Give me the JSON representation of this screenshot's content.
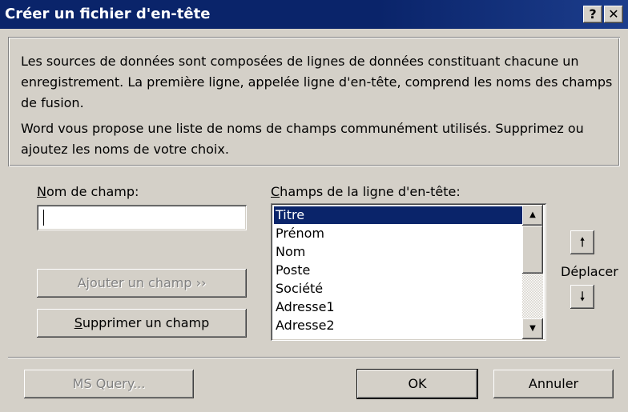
{
  "window": {
    "title": "Créer un fichier d'en-tête",
    "help_label": "?",
    "close_label": "✕"
  },
  "info": {
    "paragraph1": "Les sources de données sont composées de lignes de données constituant chacune un enregistrement. La première ligne, appelée ligne d'en-tête, comprend les noms des champs de fusion.",
    "paragraph2": "Word vous propose une liste de noms de champs communément utilisés. Supprimez ou ajoutez les noms de votre choix."
  },
  "field_name": {
    "label_accel": "N",
    "label_rest": "om de champ:",
    "value": ""
  },
  "header_fields": {
    "label_accel": "C",
    "label_rest": "hamps de la ligne d'en-tête:",
    "items": [
      "Titre",
      "Prénom",
      "Nom",
      "Poste",
      "Société",
      "Adresse1",
      "Adresse2"
    ],
    "selected": "Titre"
  },
  "buttons": {
    "add_field": "Ajouter un champ  ››",
    "remove_accel": "S",
    "remove_rest": "upprimer un champ",
    "ms_query": "MS Query...",
    "ok": "OK",
    "cancel": "Annuler"
  },
  "move": {
    "label": "Déplacer",
    "up_icon": "arrow-up-icon",
    "down_icon": "arrow-down-icon"
  },
  "colors": {
    "titlebar": "#0a246a",
    "dialog_bg": "#d4d0c8",
    "selection": "#0a246a"
  }
}
